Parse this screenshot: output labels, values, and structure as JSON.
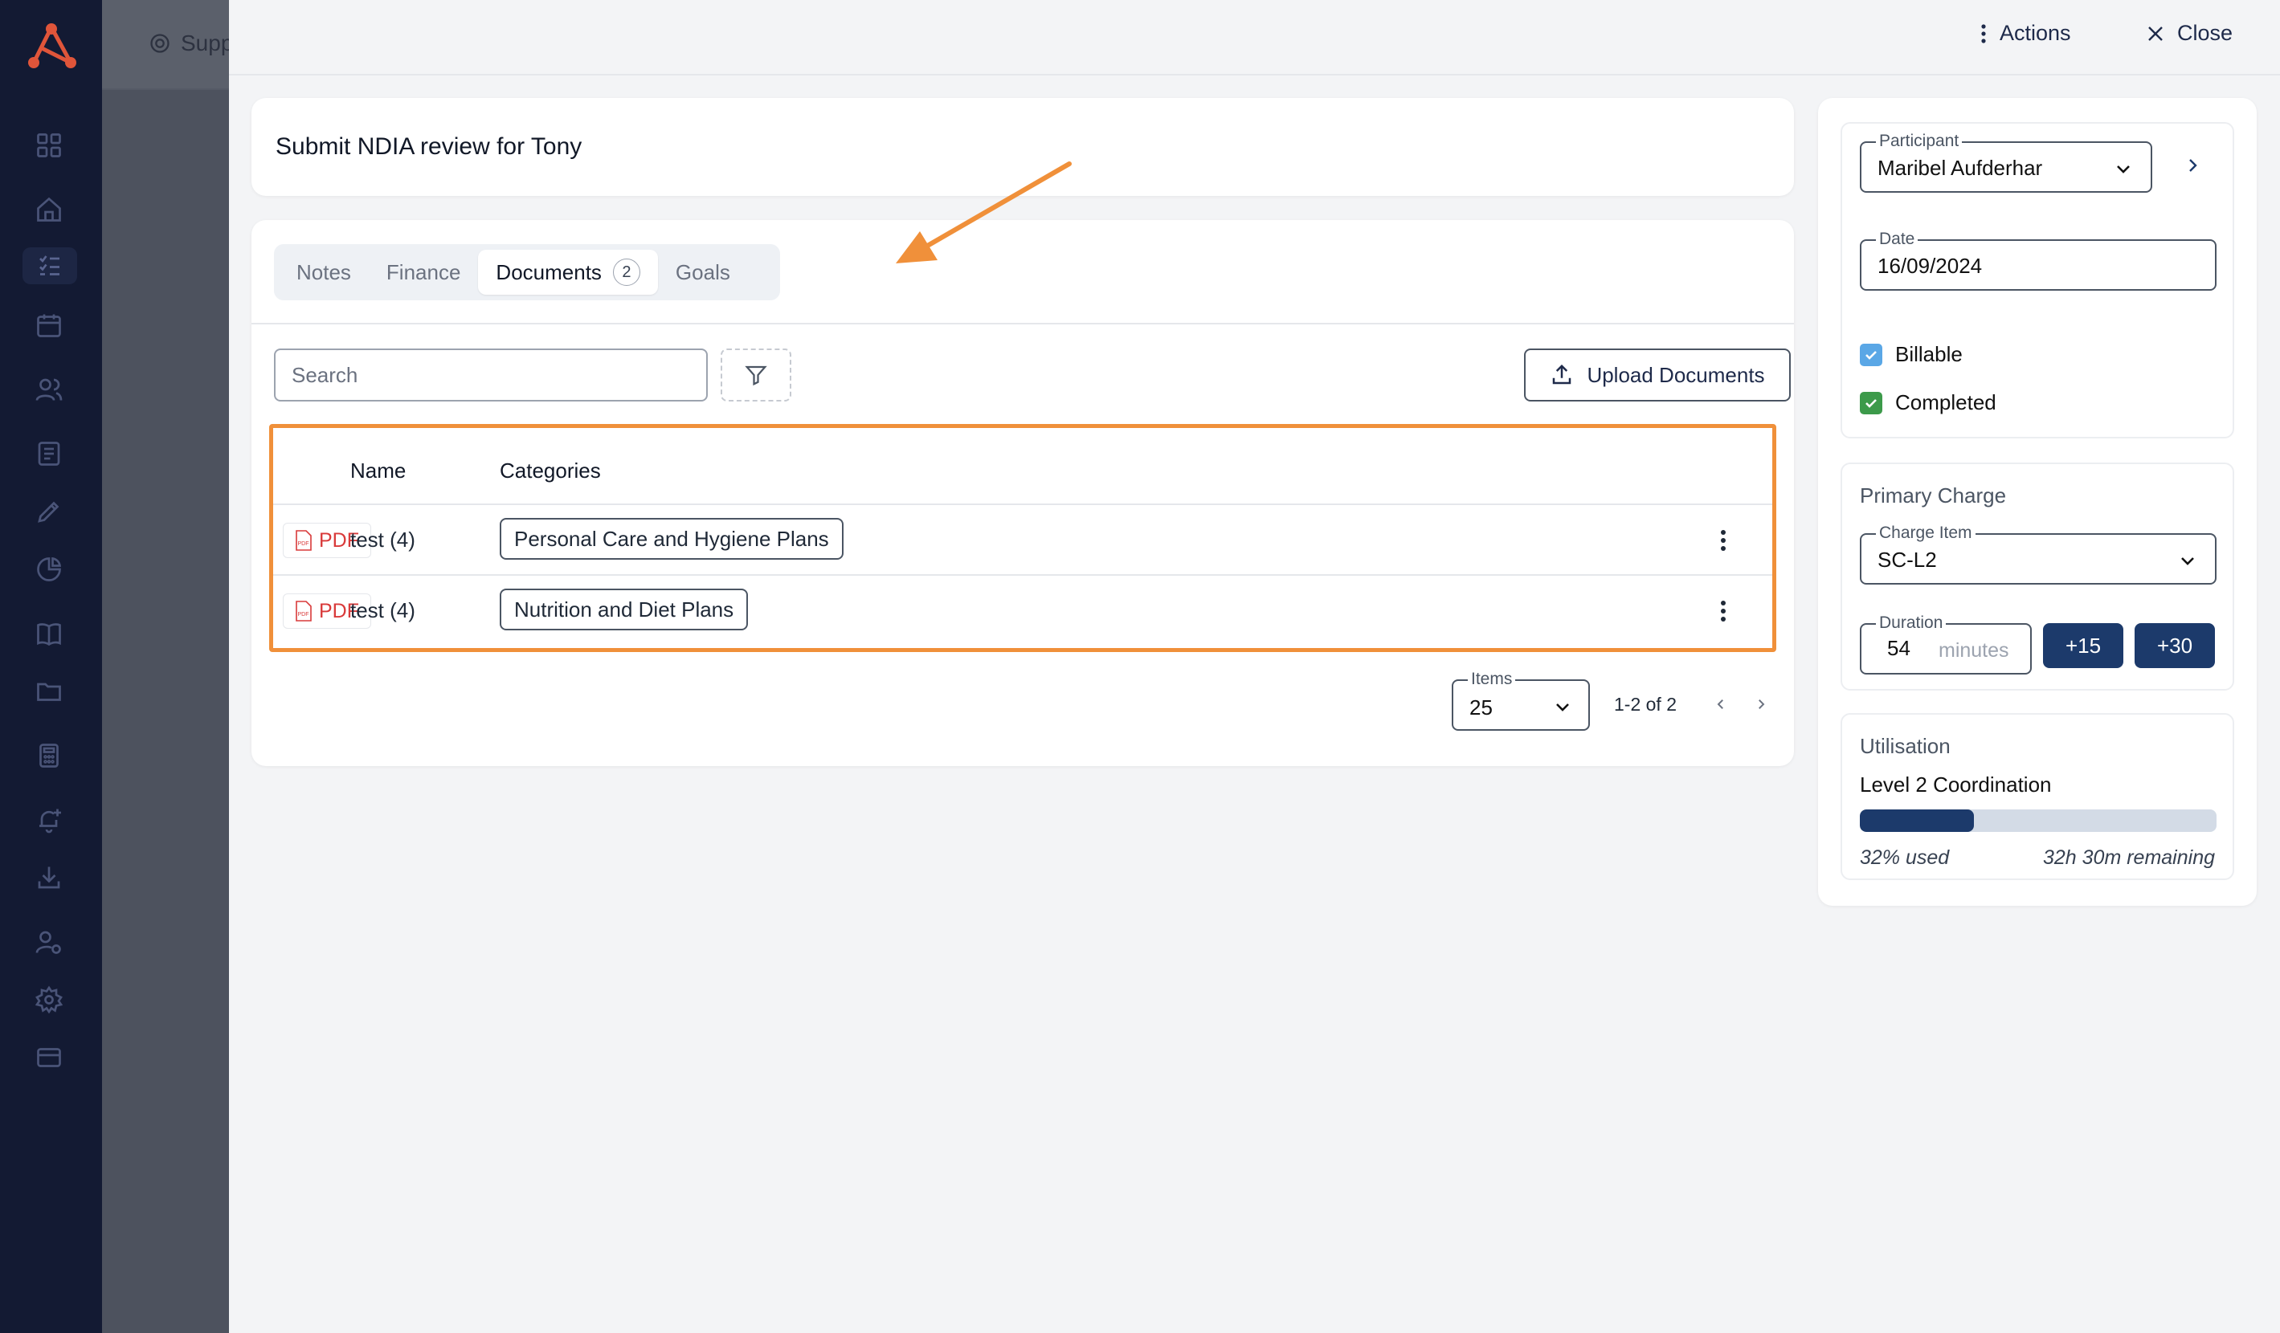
{
  "underlay": {
    "crumb": "Supp"
  },
  "header": {
    "actions_label": "Actions",
    "close_label": "Close"
  },
  "task": {
    "title": "Submit NDIA review for Tony"
  },
  "tabs": [
    {
      "label": "Notes",
      "active": false
    },
    {
      "label": "Finance",
      "active": false
    },
    {
      "label": "Documents",
      "active": true,
      "count": "2"
    },
    {
      "label": "Goals",
      "active": false
    }
  ],
  "search": {
    "placeholder": "Search"
  },
  "upload_label": "Upload Documents",
  "table": {
    "columns": [
      "Name",
      "Categories"
    ],
    "rows": [
      {
        "type": "PDF",
        "name": "test (4)",
        "category": "Personal Care and Hygiene Plans"
      },
      {
        "type": "PDF",
        "name": "test (4)",
        "category": "Nutrition and Diet Plans"
      }
    ]
  },
  "pagination": {
    "items_label": "Items",
    "page_size": "25",
    "range": "1-2 of 2"
  },
  "details": {
    "participant_label": "Participant",
    "participant": "Maribel Aufderhar",
    "date_label": "Date",
    "date": "16/09/2024",
    "billable_label": "Billable",
    "billable": true,
    "completed_label": "Completed",
    "completed": true
  },
  "charge": {
    "title": "Primary Charge",
    "item_label": "Charge Item",
    "item": "SC-L2",
    "duration_label": "Duration",
    "duration": "54",
    "duration_unit": "minutes",
    "add15": "+15",
    "add30": "+30"
  },
  "utilisation": {
    "title": "Utilisation",
    "category": "Level 2 Coordination",
    "used_percent": 32,
    "used_text": "32% used",
    "remaining_text": "32h 30m remaining"
  },
  "colors": {
    "highlight": "#f0903a",
    "primary": "#1c3a6b",
    "billable": "#5aa7e6",
    "completed": "#3c9a4a",
    "pdf": "#d93a3a"
  }
}
